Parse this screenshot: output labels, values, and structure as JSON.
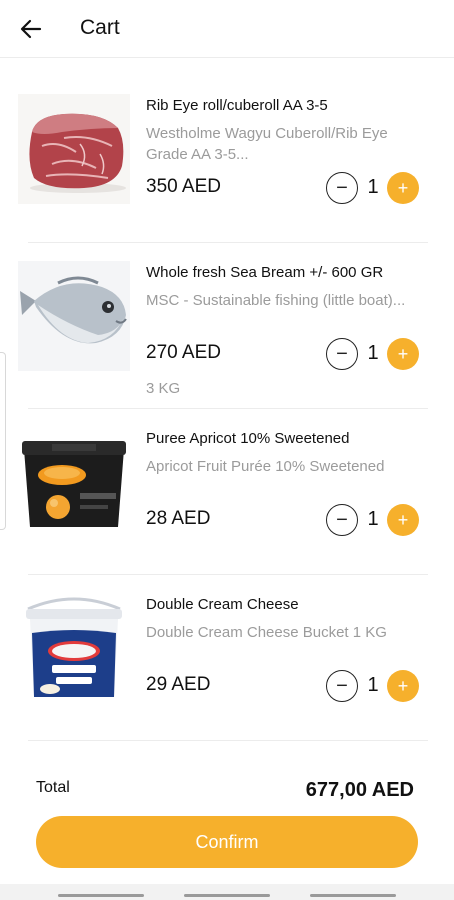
{
  "header": {
    "title": "Cart",
    "back_icon": "arrow-left-icon"
  },
  "items": [
    {
      "name": "Rib Eye roll/cuberoll AA 3-5",
      "description": "Westholme Wagyu Cuberoll/Rib Eye Grade AA 3-5...",
      "price": "350 AED",
      "quantity": "1",
      "weight": "",
      "image": "ribeye-image"
    },
    {
      "name": "Whole fresh Sea Bream +/- 600 GR",
      "description": "MSC - Sustainable fishing (little boat)...",
      "price": "270 AED",
      "quantity": "1",
      "weight": "3 KG",
      "image": "sea-bream-image"
    },
    {
      "name": "Puree Apricot 10% Sweetened",
      "description": "Apricot Fruit Purée 10% Sweetened",
      "price": "28 AED",
      "quantity": "1",
      "weight": "",
      "image": "apricot-puree-image"
    },
    {
      "name": "Double Cream Cheese",
      "description": "Double Cream Cheese Bucket 1 KG",
      "price": "29 AED",
      "quantity": "1",
      "weight": "",
      "image": "cream-cheese-image"
    }
  ],
  "controls": {
    "minus": "−",
    "plus": "+"
  },
  "summary": {
    "total_label": "Total",
    "total_value": "677,00 AED"
  },
  "confirm_label": "Confirm",
  "colors": {
    "accent": "#f6b02c",
    "muted": "#9b9b9b"
  }
}
